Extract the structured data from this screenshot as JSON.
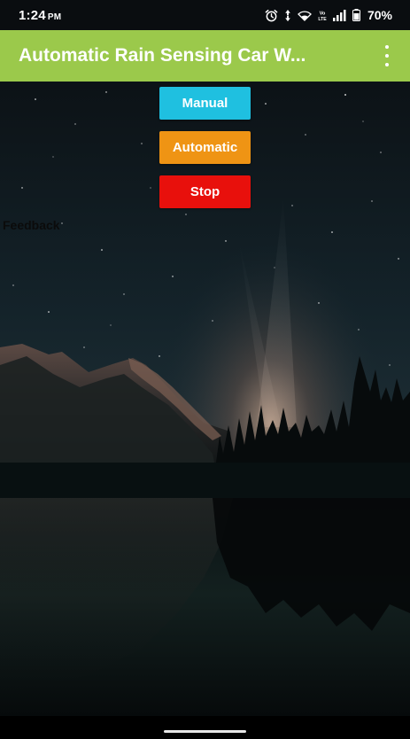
{
  "status_bar": {
    "time": "1:24",
    "ampm": "PM",
    "battery": "70%",
    "icons": [
      "alarm-icon",
      "data-arrows-icon",
      "wifi-icon",
      "volte-icon",
      "signal-icon",
      "battery-icon"
    ],
    "volte_text": "Vo LTE"
  },
  "app_bar": {
    "title": "Automatic Rain Sensing Car W...",
    "color": "#9bc94b",
    "menu_icon": "more-vert-icon"
  },
  "buttons": {
    "manual": {
      "label": "Manual",
      "color": "#1fc0e0"
    },
    "automatic": {
      "label": "Automatic",
      "color": "#ef9414"
    },
    "stop": {
      "label": "Stop",
      "color": "#e8100c"
    }
  },
  "feedback": {
    "label": "Feedback"
  },
  "background": {
    "description_icon": "night-lake-wallpaper"
  }
}
